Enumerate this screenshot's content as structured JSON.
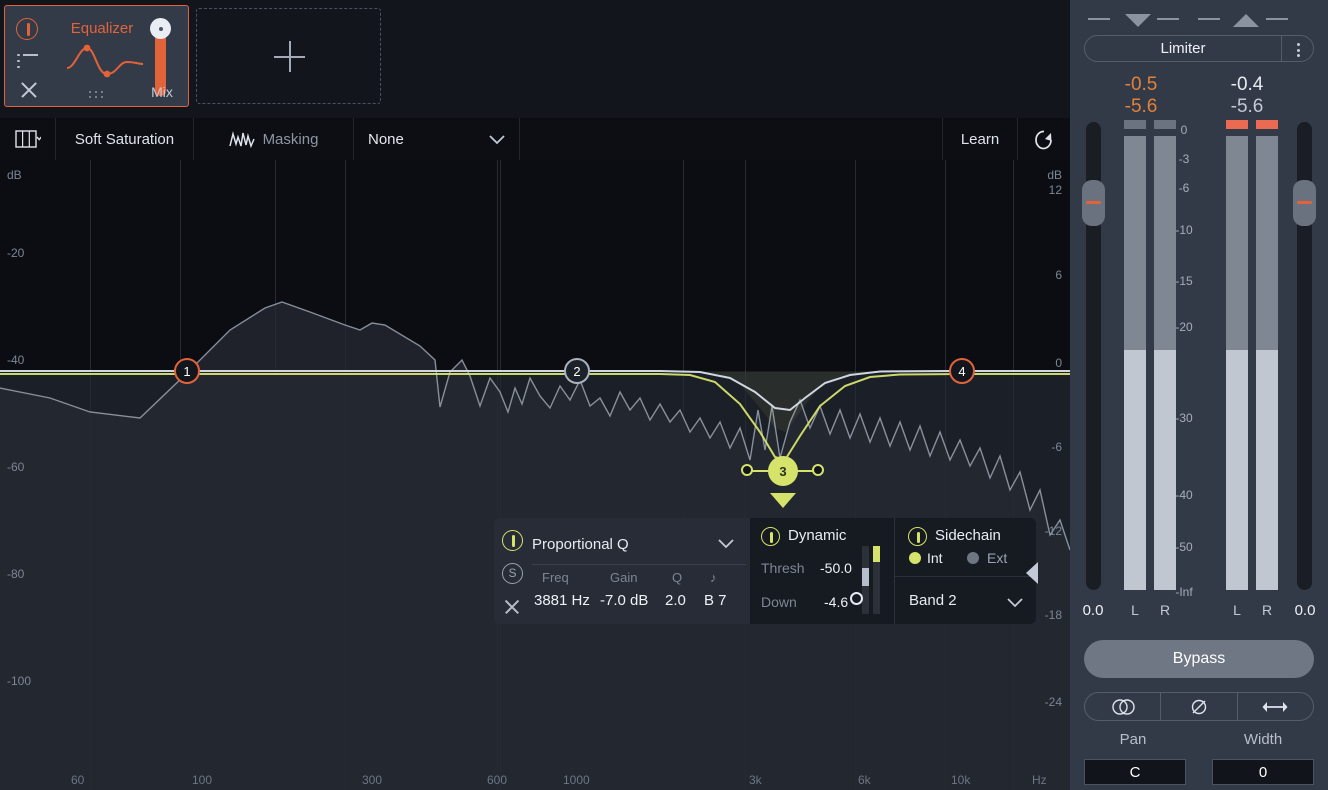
{
  "module": {
    "title": "Equalizer",
    "mix_label": "Mix",
    "power_icon": "power-icon",
    "menu_icon": "list-menu-icon",
    "close_icon": "close-icon",
    "curve_icon": "eq-curve-icon",
    "grip_icon": "drag-grip-icon",
    "add_icon": "plus-icon",
    "accent": "#e2633a"
  },
  "toolbar": {
    "grid_icon": "column-layout-icon",
    "preset_name": "Soft Saturation",
    "masking_icon": "masking-waveform-icon",
    "masking_label": "Masking",
    "masking_value": "None",
    "learn_label": "Learn",
    "loop_icon": "reset-loop-icon"
  },
  "graph": {
    "left_axis_title": "dB",
    "left_ticks": [
      "-20",
      "-40",
      "-60",
      "-80",
      "-100"
    ],
    "right_axis_title": "dB",
    "right_ticks": [
      "12",
      "6",
      "0",
      "-6",
      "-12",
      "-18",
      "-24"
    ],
    "freq_ticks": [
      "60",
      "100",
      "300",
      "600",
      "1000",
      "3k",
      "6k",
      "10k"
    ],
    "freq_unit": "Hz",
    "bands": [
      {
        "label": "1",
        "state": "enabled"
      },
      {
        "label": "2",
        "state": "neutral"
      },
      {
        "label": "3",
        "state": "selected"
      },
      {
        "label": "4",
        "state": "enabled"
      }
    ],
    "band_colors": {
      "enabled": "#e2633a",
      "neutral": "#aab2be",
      "selected": "#d6e36b"
    }
  },
  "popup": {
    "power_icon": "power-icon",
    "solo_icon": "solo-icon",
    "close_icon": "close-icon",
    "shape": "Proportional Q",
    "param_headers": [
      "Freq",
      "Gain",
      "Q",
      "♪"
    ],
    "param_values": [
      "3881 Hz",
      "-7.0 dB",
      "2.0",
      "B 7"
    ],
    "dynamic": {
      "title": "Dynamic",
      "thresh_label": "Thresh",
      "thresh_value": "-50.0",
      "down_label": "Down",
      "down_value": "-4.6"
    },
    "sidechain": {
      "title": "Sidechain",
      "int_label": "Int",
      "ext_label": "Ext",
      "selected": "Int",
      "band": "Band 2"
    },
    "collapse_icon": "collapse-arrow-icon"
  },
  "right_panel": {
    "title": "Limiter",
    "menu_icon": "kebab-menu-icon",
    "collapse_icon": "triangle-down-icon",
    "expand_icon": "triangle-up-icon",
    "input": {
      "peak": "-0.5",
      "rms": "-5.6",
      "left_label": "L",
      "right_label": "R",
      "gain": "0.0"
    },
    "output": {
      "peak": "-0.4",
      "rms": "-5.6",
      "left_label": "L",
      "right_label": "R",
      "gain": "0.0"
    },
    "scale": [
      "0",
      "-3",
      "-6",
      "-10",
      "-15",
      "-20",
      "-30",
      "-40",
      "-50",
      "-Inf"
    ],
    "bypass_label": "Bypass",
    "seg_buttons": [
      "stereo-link-icon",
      "phase-invert-icon",
      "width-arrows-icon"
    ],
    "pan_label": "Pan",
    "pan_value": "C",
    "width_label": "Width",
    "width_value": "0",
    "input_peak_color": "#e2823a",
    "output_peak_color": "#e2633a"
  }
}
